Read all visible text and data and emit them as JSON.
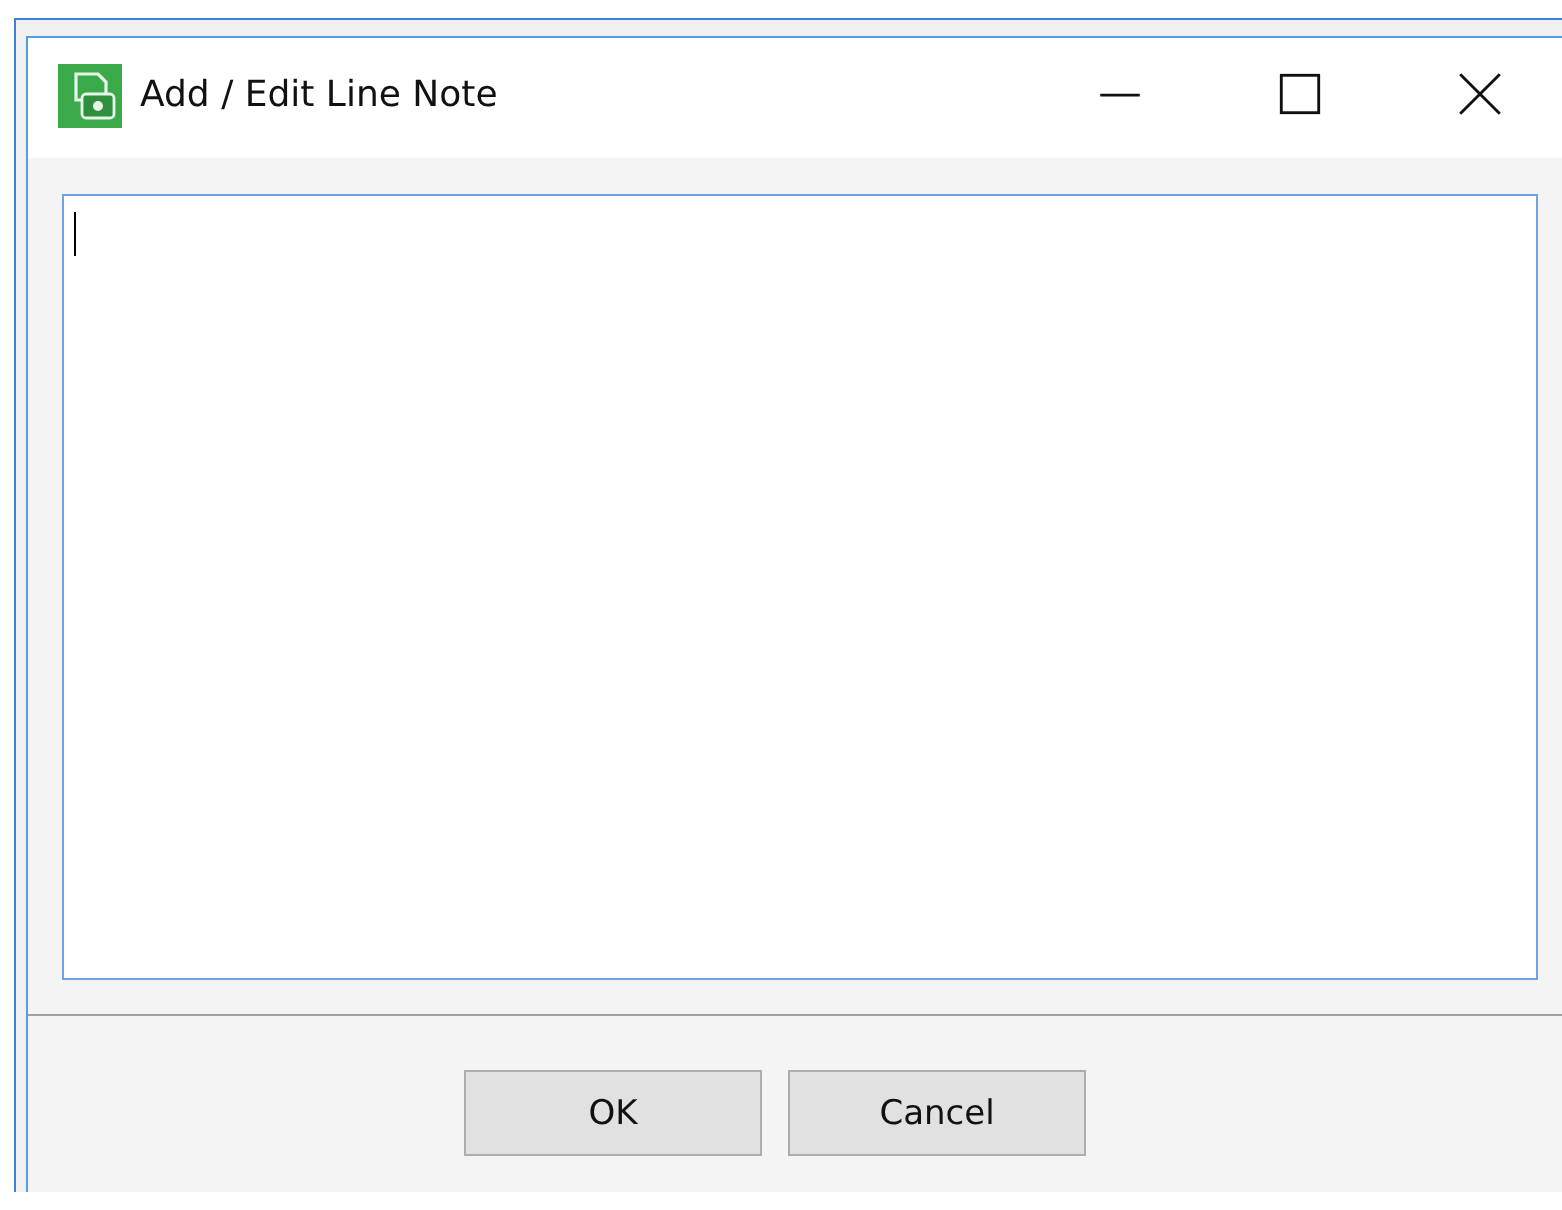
{
  "window": {
    "title": "Add / Edit Line Note"
  },
  "note_field": {
    "focused": true
  },
  "buttons": [
    {
      "label": "OK"
    },
    {
      "label": "Cancel"
    }
  ]
}
